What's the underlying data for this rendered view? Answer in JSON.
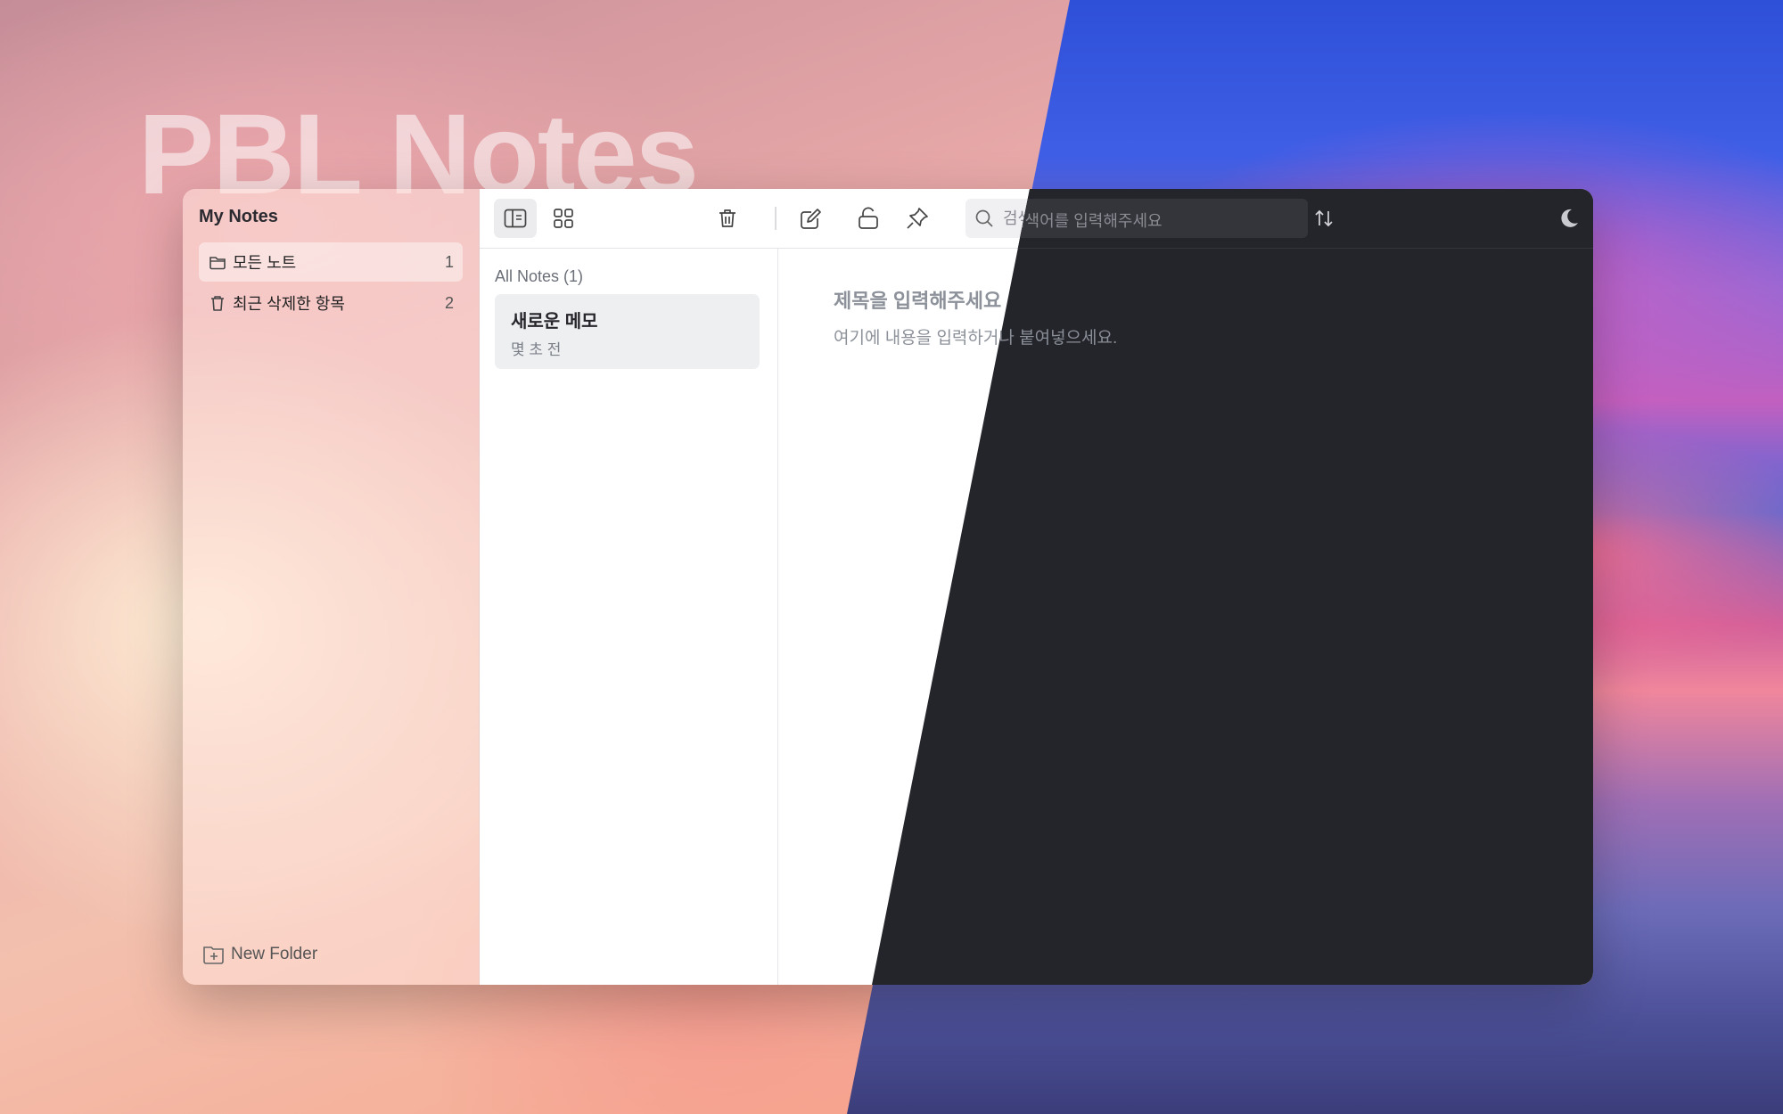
{
  "hero": {
    "title": "PBL Notes"
  },
  "sidebar": {
    "title": "My Notes",
    "folders": [
      {
        "label": "모든 노트",
        "count": "1",
        "icon": "folder-icon"
      },
      {
        "label": "최근 삭제한 항목",
        "count": "2",
        "icon": "trash-icon"
      }
    ],
    "new_folder_label": "New Folder"
  },
  "toolbar": {
    "icons": [
      "list-view-icon",
      "grid-view-icon",
      "trash-icon",
      "compose-icon",
      "lock-icon",
      "pin-icon",
      "sort-icon",
      "moon-icon"
    ],
    "search_placeholder": "검색어를 입력해주세요"
  },
  "note_list": {
    "header": "All Notes (1)",
    "notes": [
      {
        "title": "새로운 메모",
        "time": "몇 초 전"
      }
    ]
  },
  "editor": {
    "title_placeholder": "제목을 입력해주세요",
    "body_placeholder": "여기에 내용을 입력하거나 붙여넣으세요."
  },
  "colors": {
    "dark_bg": "#24252a",
    "light_bg": "#ffffff",
    "selected_note": "#eeeff1"
  }
}
